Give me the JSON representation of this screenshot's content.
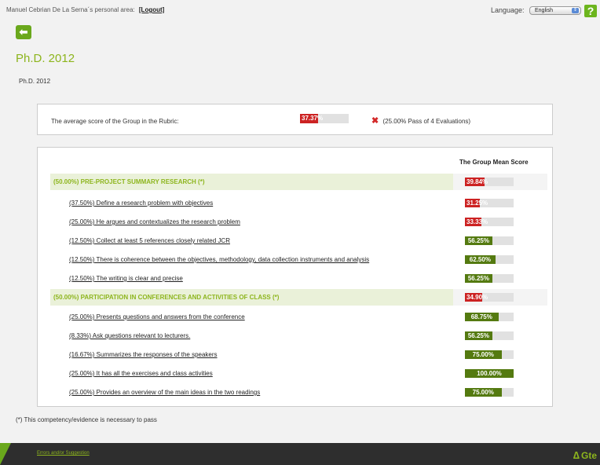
{
  "header": {
    "user_text": "Manuel Cebrian De La Serna´s personal area:",
    "logout_label": "[Logout]",
    "language_label": "Language:",
    "language_value": "English",
    "help_label": "?"
  },
  "back_button_glyph": "⬅",
  "title": "Ph.D. 2012",
  "subtitle": "Ph.D. 2012",
  "summary": {
    "label": "The average score of the Group in the Rubric:",
    "score": 37.37,
    "score_text": "37.37%",
    "result_text": "(25.00% Pass of 4 Evaluations)"
  },
  "table": {
    "column_header": "The Group Mean Score",
    "rows": [
      {
        "type": "section",
        "label": "(50.00%) PRE-PROJECT SUMMARY RESEARCH (*)",
        "score": 39.84,
        "score_text": "39.84%",
        "status": "fail"
      },
      {
        "type": "item",
        "label": "(37.50%) Define a research problem with objectives",
        "score": 31.25,
        "score_text": "31.25%",
        "status": "fail"
      },
      {
        "type": "item",
        "label": "(25.00%) He argues and contextualizes the research problem",
        "score": 33.33,
        "score_text": "33.33%",
        "status": "fail"
      },
      {
        "type": "item",
        "label": "(12.50%) Collect at least 5 references closely related JCR",
        "score": 56.25,
        "score_text": "56.25%",
        "status": "pass"
      },
      {
        "type": "item",
        "label": "(12.50%) There is coherence between the objectives, methodology, data collection instruments and analysis",
        "score": 62.5,
        "score_text": "62.50%",
        "status": "pass"
      },
      {
        "type": "item",
        "label": "(12.50%) The writing is clear and precise",
        "score": 56.25,
        "score_text": "56.25%",
        "status": "pass"
      },
      {
        "type": "section",
        "label": "(50.00%) PARTICIPATION IN CONFERENCES AND ACTIVITIES OF CLASS (*)",
        "score": 34.9,
        "score_text": "34.90%",
        "status": "fail"
      },
      {
        "type": "item",
        "label": "(25.00%) Presents questions and answers from the conference",
        "score": 68.75,
        "score_text": "68.75%",
        "status": "pass"
      },
      {
        "type": "item",
        "label": "(8.33%) Ask questions relevant to lecturers.",
        "score": 56.25,
        "score_text": "56.25%",
        "status": "pass"
      },
      {
        "type": "item",
        "label": "(16.67%) Summarizes the responses of the speakers",
        "score": 75,
        "score_text": "75.00%",
        "status": "pass"
      },
      {
        "type": "item",
        "label": "(25.00%) It has all the exercises and class activities",
        "score": 100,
        "score_text": "100.00%",
        "status": "pass"
      },
      {
        "type": "item",
        "label": "(25.00%) Provides an overview of the main ideas in the two readings",
        "score": 75,
        "score_text": "75.00%",
        "status": "pass"
      }
    ]
  },
  "footnote": "(*) This competency/evidence is necessary to pass",
  "footer": {
    "link_label": "Errors and/or Suggestion",
    "logo_text": "Gte"
  },
  "colors": {
    "accent_green": "#8db51d",
    "fail_red": "#cc2222",
    "pass_green": "#547a10"
  }
}
